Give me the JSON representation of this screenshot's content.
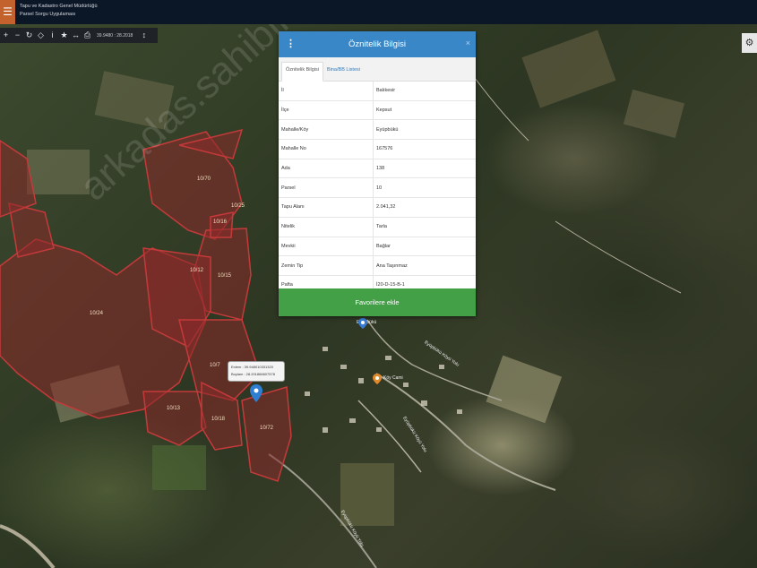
{
  "app": {
    "menu_icon": "hamburger-icon",
    "title_line1": "Tapu ve Kadastro Genel Müdürlüğü",
    "title_line2": "Parsel Sorgu Uygulaması"
  },
  "toolbar": {
    "coords": "39.9480 : 28.2018",
    "icons": [
      "zoom-in-icon",
      "zoom-out-icon",
      "refresh-icon",
      "locate-icon",
      "info-icon",
      "star-icon",
      "measure-icon",
      "print-icon"
    ],
    "extra": "↕"
  },
  "panel": {
    "title": "Öznitelik Bilgisi",
    "close": "×",
    "tabs": [
      "Öznitelik Bilgisi",
      "Bina/BB Listesi"
    ],
    "rows": [
      {
        "key": "İl",
        "value": "Balıkesir"
      },
      {
        "key": "İlçe",
        "value": "Kepsut"
      },
      {
        "key": "Mahalle/Köy",
        "value": "Eyüpbükü"
      },
      {
        "key": "Mahalle No",
        "value": "167576"
      },
      {
        "key": "Ada",
        "value": "138"
      },
      {
        "key": "Parsel",
        "value": "10"
      },
      {
        "key": "Tapu Alanı",
        "value": "2.041,32"
      },
      {
        "key": "Nitelik",
        "value": "Tarla"
      },
      {
        "key": "Mevkii",
        "value": "Bağlar"
      },
      {
        "key": "Zemin Tip",
        "value": "Ana Taşınmaz"
      },
      {
        "key": "Pafta",
        "value": "İ20-D-15-B-1"
      }
    ],
    "favorite_button": "Favorilere ekle"
  },
  "map": {
    "tooltip_line1": "Enlem : 39.948010331320",
    "tooltip_line2": "Boylam : 28.201866607578",
    "parcel_labels": [
      "10/70",
      "10/25",
      "10/16",
      "10/12",
      "10/15",
      "10/24",
      "10/7",
      "10/13",
      "10/18",
      "10/72"
    ],
    "road_label_1": "Eyüpbükü Köyü Yolu",
    "road_label_2": "Eyüpbükü Köyü Yolu",
    "road_label_3": "Eyüpbükü Köyü Yolu",
    "poi_label": "Eyüpbükü",
    "poi2_label": "Köy Cami",
    "watermark": "arkadas.sahibinden.com",
    "parcel_color": "#8a2a2a"
  }
}
